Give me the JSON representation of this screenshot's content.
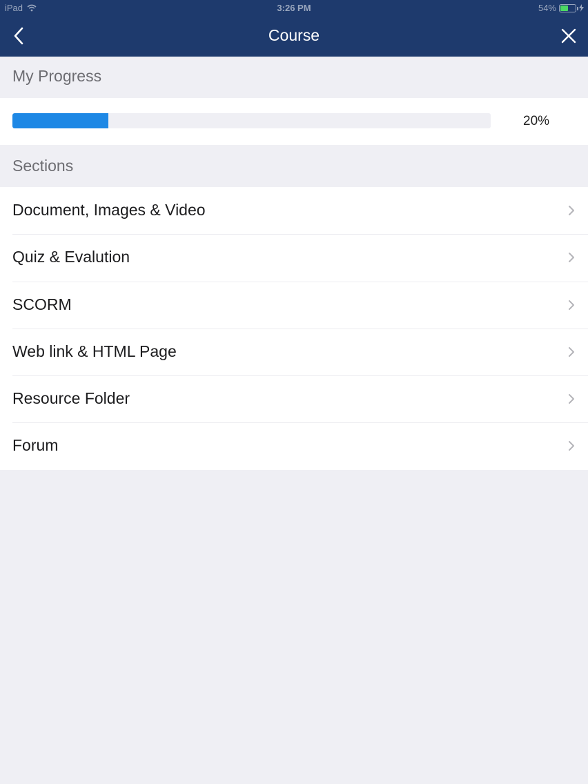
{
  "status_bar": {
    "device": "iPad",
    "time": "3:26 PM",
    "battery_percent": "54%",
    "battery_level": 0.54,
    "battery_color": "#4cd964",
    "wifi_icon": "wifi-icon"
  },
  "nav": {
    "title": "Course",
    "back_icon": "chevron-left-icon",
    "close_icon": "close-icon",
    "bar_color": "#1e3a6d"
  },
  "progress": {
    "header": "My Progress",
    "percent_label": "20%",
    "value": 0.2,
    "fill_color": "#1e88e5"
  },
  "sections": {
    "header": "Sections",
    "chevron_icon": "chevron-right-icon",
    "items": [
      {
        "label": "Document, Images & Video"
      },
      {
        "label": "Quiz & Evalution"
      },
      {
        "label": "SCORM"
      },
      {
        "label": "Web link & HTML Page"
      },
      {
        "label": "Resource Folder"
      },
      {
        "label": "Forum"
      }
    ]
  }
}
